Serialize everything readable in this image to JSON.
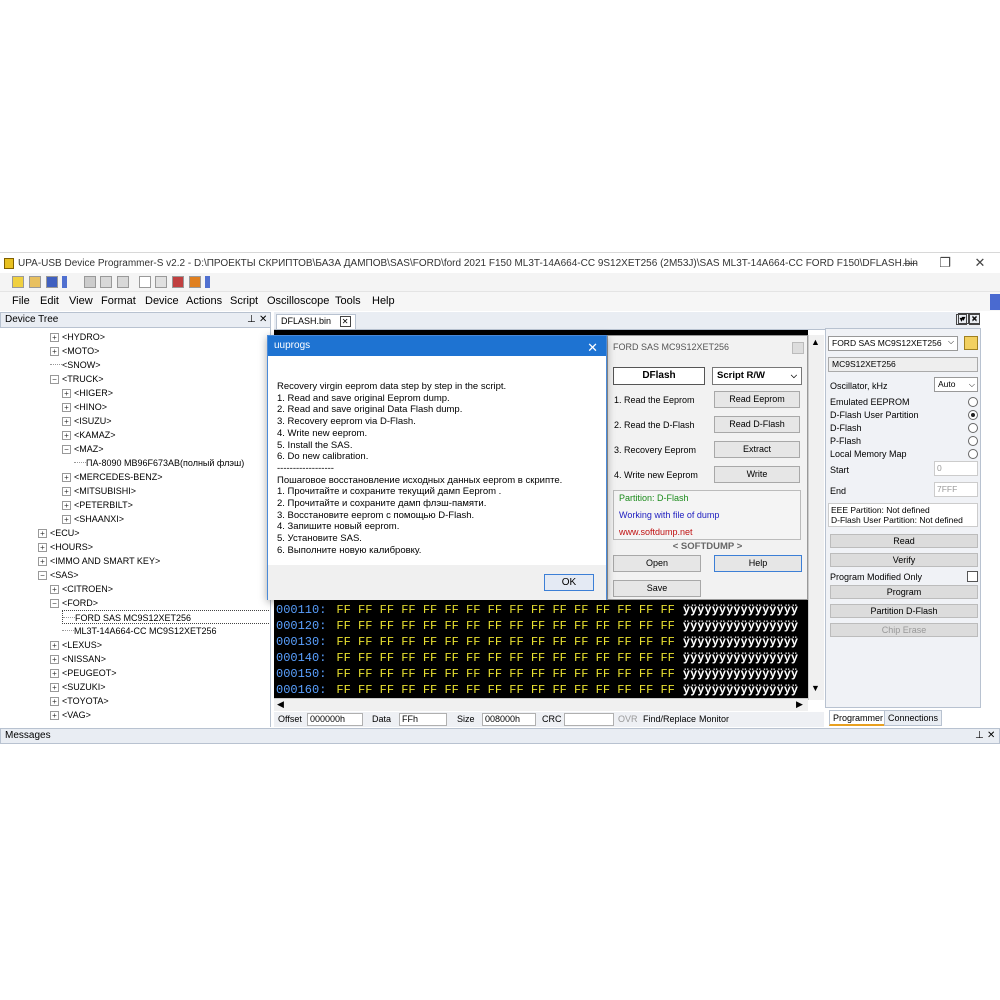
{
  "window": {
    "title": "UPA-USB Device Programmer-S v2.2 - D:\\ПРОЕКТЫ СКРИПТОВ\\БАЗА ДАМПОВ\\SAS\\FORD\\ford 2021 F150 ML3T-14A664-CC 9S12XET256 (2M53J)\\SAS ML3T-14A664-CC FORD F150\\DFLASH.bin",
    "minimize": "—",
    "maximize": "❐",
    "close": "✕"
  },
  "menu": [
    "File",
    "Edit",
    "View",
    "Format",
    "Device",
    "Actions",
    "Script",
    "Oscilloscope",
    "Tools",
    "Help"
  ],
  "device_tree": {
    "title": "Device Tree",
    "pin": "⊥",
    "close": "✕",
    "rows": [
      {
        "label": "<HYDRO>",
        "indent": 1,
        "exp": "+"
      },
      {
        "label": "<MOTO>",
        "indent": 1,
        "exp": "+"
      },
      {
        "label": "<SNOW>",
        "indent": 1,
        "exp": ""
      },
      {
        "label": "<TRUCK>",
        "indent": 1,
        "exp": "−"
      },
      {
        "label": "<HIGER>",
        "indent": 2,
        "exp": "+"
      },
      {
        "label": "<HINO>",
        "indent": 2,
        "exp": "+"
      },
      {
        "label": "<ISUZU>",
        "indent": 2,
        "exp": "+"
      },
      {
        "label": "<KAMAZ>",
        "indent": 2,
        "exp": "+"
      },
      {
        "label": "<MAZ>",
        "indent": 2,
        "exp": "−"
      },
      {
        "label": "ПА-8090 MB96F673AB(полный флэш)",
        "indent": 3,
        "exp": ""
      },
      {
        "label": "<MERCEDES-BENZ>",
        "indent": 2,
        "exp": "+"
      },
      {
        "label": "<MITSUBISHI>",
        "indent": 2,
        "exp": "+"
      },
      {
        "label": "<PETERBILT>",
        "indent": 2,
        "exp": "+"
      },
      {
        "label": "<SHAANXI>",
        "indent": 2,
        "exp": "+"
      },
      {
        "label": "<ECU>",
        "indent": 0,
        "exp": "+"
      },
      {
        "label": "<HOURS>",
        "indent": 0,
        "exp": "+"
      },
      {
        "label": "<IMMO AND SMART KEY>",
        "indent": 0,
        "exp": "+"
      },
      {
        "label": "<SAS>",
        "indent": 0,
        "exp": "−"
      },
      {
        "label": "<CITROEN>",
        "indent": 1,
        "exp": "+"
      },
      {
        "label": "<FORD>",
        "indent": 1,
        "exp": "−"
      },
      {
        "label": "FORD SAS MC9S12XET256",
        "indent": 2,
        "exp": "",
        "selected": true
      },
      {
        "label": "ML3T-14A664-CC MC9S12XET256",
        "indent": 2,
        "exp": ""
      },
      {
        "label": "<LEXUS>",
        "indent": 1,
        "exp": "+"
      },
      {
        "label": "<NISSAN>",
        "indent": 1,
        "exp": "+"
      },
      {
        "label": "<PEUGEOT>",
        "indent": 1,
        "exp": "+"
      },
      {
        "label": "<SUZUKI>",
        "indent": 1,
        "exp": "+"
      },
      {
        "label": "<TOYOTA>",
        "indent": 1,
        "exp": "+"
      },
      {
        "label": "<VAG>",
        "indent": 1,
        "exp": "+"
      }
    ]
  },
  "editor": {
    "tab_label": "DFLASH.bin",
    "tab_close": "✕",
    "hex_rows": [
      {
        "addr": "000110:",
        "bytes": "FF FF FF FF FF FF FF FF FF FF FF FF FF FF FF FF",
        "ascii": "ÿÿÿÿÿÿÿÿÿÿÿÿÿÿÿÿ"
      },
      {
        "addr": "000120:",
        "bytes": "FF FF FF FF FF FF FF FF FF FF FF FF FF FF FF FF",
        "ascii": "ÿÿÿÿÿÿÿÿÿÿÿÿÿÿÿÿ"
      },
      {
        "addr": "000130:",
        "bytes": "FF FF FF FF FF FF FF FF FF FF FF FF FF FF FF FF",
        "ascii": "ÿÿÿÿÿÿÿÿÿÿÿÿÿÿÿÿ"
      },
      {
        "addr": "000140:",
        "bytes": "FF FF FF FF FF FF FF FF FF FF FF FF FF FF FF FF",
        "ascii": "ÿÿÿÿÿÿÿÿÿÿÿÿÿÿÿÿ"
      },
      {
        "addr": "000150:",
        "bytes": "FF FF FF FF FF FF FF FF FF FF FF FF FF FF FF FF",
        "ascii": "ÿÿÿÿÿÿÿÿÿÿÿÿÿÿÿÿ"
      },
      {
        "addr": "000160:",
        "bytes": "FF FF FF FF FF FF FF FF FF FF FF FF FF FF FF FF",
        "ascii": "ÿÿÿÿÿÿÿÿÿÿÿÿÿÿÿÿ"
      }
    ],
    "status": {
      "offset_label": "Offset",
      "offset_value": "000000h",
      "data_label": "Data",
      "data_value": "FFh",
      "size_label": "Size",
      "size_value": "008000h",
      "crc_label": "CRC",
      "crc_value": "",
      "ovr": "OVR",
      "find_replace": "Find/Replace",
      "monitor": "Monitor"
    }
  },
  "dialog": {
    "title": "uuprogs",
    "close": "✕",
    "lines": [
      "Recovery virgin eeprom data step by step in the script.",
      "1. Read and save original Eeprom dump.",
      "2. Read and save original Data Flash dump.",
      "3. Recovery eeprom via D-Flash.",
      "4. Write new eeprom.",
      "5. Install the SAS.",
      "6. Do new calibration.",
      "------------------",
      "Пошаговое восстановление исходных данных eeprom в скрипте.",
      "1. Прочитайте и сохраните текущий дамп Eeprom .",
      "2. Прочитайте и сохраните дамп флэш-памяти.",
      "3. Восстановите eeprom с помощью D-Flash.",
      "4. Запишите новый eeprom.",
      "5. Установите SAS.",
      "6. Выполните новую калибровку."
    ],
    "ok": "OK"
  },
  "script_panel": {
    "title": "FORD SAS MC9S12XET256",
    "mode_label": "DFlash",
    "mode_select": "Script R/W",
    "steps": [
      {
        "label": "1. Read the Eeprom",
        "button": "Read Eeprom"
      },
      {
        "label": "2. Read the D-Flash",
        "button": "Read D-Flash"
      },
      {
        "label": "3. Recovery Eeprom",
        "button": "Extract"
      },
      {
        "label": "4. Write new Eeprom",
        "button": "Write"
      }
    ],
    "info_partition": "Partition: D-Flash",
    "info_working": "Working with file of dump",
    "info_url": "www.softdump.net",
    "brand": "< SOFTDUMP >",
    "open": "Open",
    "help": "Help",
    "save": "Save",
    "colors": {
      "partition": "#1a8a1a",
      "working": "#2020c0",
      "url": "#c01010"
    }
  },
  "programmer": {
    "device_select": "FORD SAS MC9S12XET256",
    "device_name": "MC9S12XET256",
    "osc_label": "Oscillator, kHz",
    "osc_value": "Auto",
    "options": [
      {
        "label": "Emulated EEPROM",
        "on": false
      },
      {
        "label": "D-Flash User Partition",
        "on": true
      },
      {
        "label": "D-Flash",
        "on": false
      },
      {
        "label": "P-Flash",
        "on": false
      },
      {
        "label": "Local Memory Map",
        "on": false
      }
    ],
    "start_label": "Start",
    "start_value": "0",
    "end_label": "End",
    "end_value": "7FFF",
    "eee_partition": "EEE Partition: Not defined",
    "dflash_partition": "D-Flash User Partition: Not defined",
    "read": "Read",
    "verify": "Verify",
    "program_modified_only": "Program Modified Only",
    "program": "Program",
    "partition_dflash": "Partition D-Flash",
    "chip_erase": "Chip Erase",
    "tab_programmer": "Programmer",
    "tab_connections": "Connections"
  },
  "messages": {
    "title": "Messages",
    "pin": "⊥",
    "close": "✕"
  }
}
